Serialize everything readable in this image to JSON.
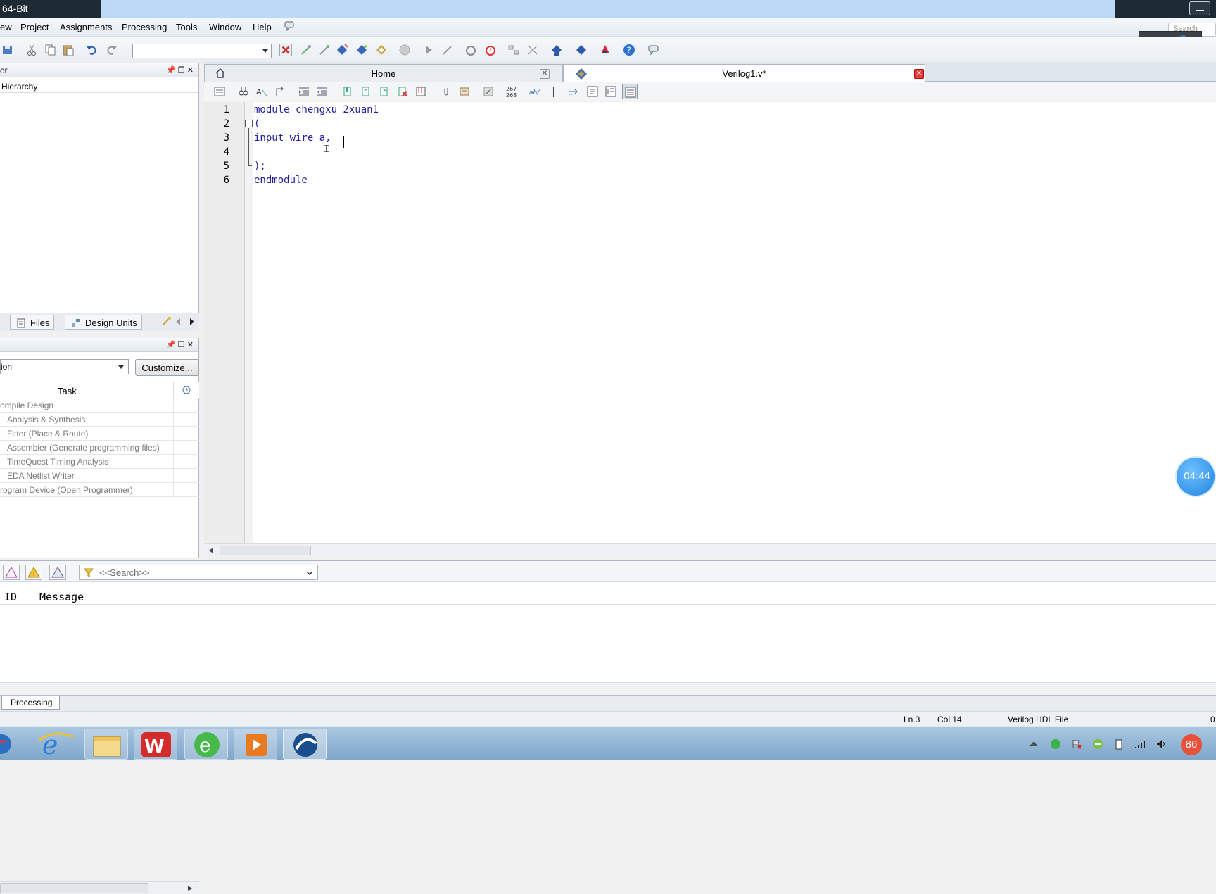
{
  "window": {
    "title": "64-Bit"
  },
  "menu": {
    "items": [
      "ew",
      "Project",
      "Assignments",
      "Processing",
      "Tools",
      "Window",
      "Help"
    ],
    "search_placeholder": "Search alte"
  },
  "toolbar": {
    "revision_value": ""
  },
  "project_navigator": {
    "title": "or",
    "hierarchy_label": "Hierarchy",
    "tabs": [
      "Files",
      "Design Units"
    ]
  },
  "tasks": {
    "flow_value": "ion",
    "customize_label": "Customize...",
    "column_task": "Task",
    "rows": [
      {
        "label": "ompile Design",
        "indent": 0
      },
      {
        "label": "Analysis & Synthesis",
        "indent": 1
      },
      {
        "label": "Fitter (Place & Route)",
        "indent": 1
      },
      {
        "label": "Assembler (Generate programming files)",
        "indent": 1
      },
      {
        "label": "TimeQuest Timing Analysis",
        "indent": 1
      },
      {
        "label": "EDA Netlist Writer",
        "indent": 1
      },
      {
        "label": "rogram Device (Open Programmer)",
        "indent": 0
      }
    ]
  },
  "editor": {
    "tabs": [
      {
        "label": "Home"
      },
      {
        "label": "Verilog1.v*"
      }
    ],
    "toolbar_numbers": {
      "top": "267",
      "bottom": "268"
    },
    "line_numbers": [
      "1",
      "2",
      "3",
      "4",
      "5",
      "6"
    ],
    "lines": [
      "module chengxu_2xuan1",
      "(",
      "input wire a,",
      "",
      ");",
      "endmodule"
    ]
  },
  "timer": {
    "text": "04:44"
  },
  "messages": {
    "search_placeholder": "<<Search>>",
    "col_id": "ID",
    "col_message": "Message"
  },
  "bottom_tabs": {
    "processing": "Processing"
  },
  "status": {
    "line": "Ln 3",
    "col": "Col 14",
    "file_type": "Verilog HDL File",
    "extra": "0"
  },
  "tray": {
    "badge": "86"
  },
  "colors": {
    "keyword": "#1f1f9e",
    "title_bar": "#bcd9f5",
    "taskbar": "#7ea6c9",
    "close_red": "#e04040"
  }
}
